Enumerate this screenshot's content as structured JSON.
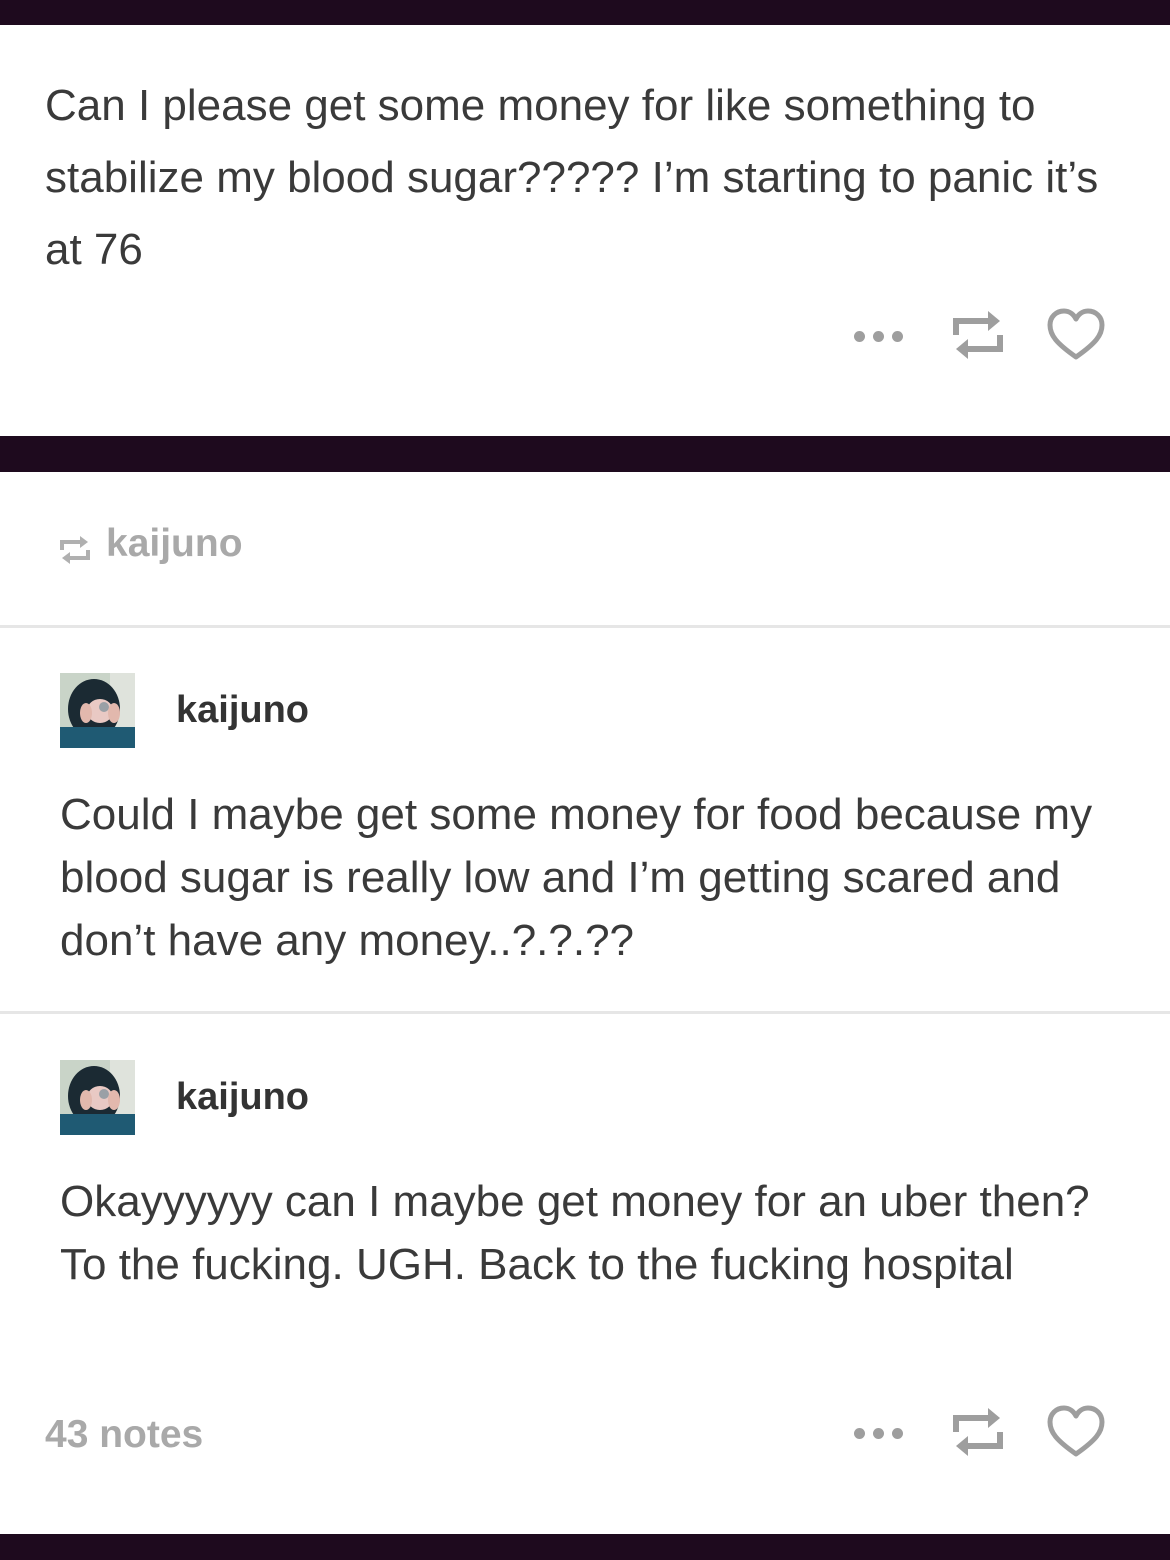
{
  "colors": {
    "band": "#1e0a1e",
    "card": "#ffffff",
    "text": "#3a3a3a",
    "muted": "#a9a9a9",
    "icon": "#9e9e9e"
  },
  "top_post": {
    "text": "Can I please get some money for like something to stabilize my blood sugar????? I’m starting to panic it’s at 76",
    "actions": [
      "more-icon",
      "reblog-icon",
      "heart-icon"
    ]
  },
  "reblog_header": {
    "icon": "reblog-icon",
    "username": "kaijuno"
  },
  "trail": [
    {
      "username": "kaijuno",
      "avatar": "avatar",
      "text": "Could I maybe get some money for food because my blood sugar is really low and I’m getting scared and don’t have any money..?.?.??"
    },
    {
      "username": "kaijuno",
      "avatar": "avatar",
      "text": "Okayyyyyy can I maybe get money for an uber then? To the fucking. UGH. Back to the fucking hospital"
    }
  ],
  "footer": {
    "notes": "43 notes",
    "actions": [
      "more-icon",
      "reblog-icon",
      "heart-icon"
    ]
  }
}
